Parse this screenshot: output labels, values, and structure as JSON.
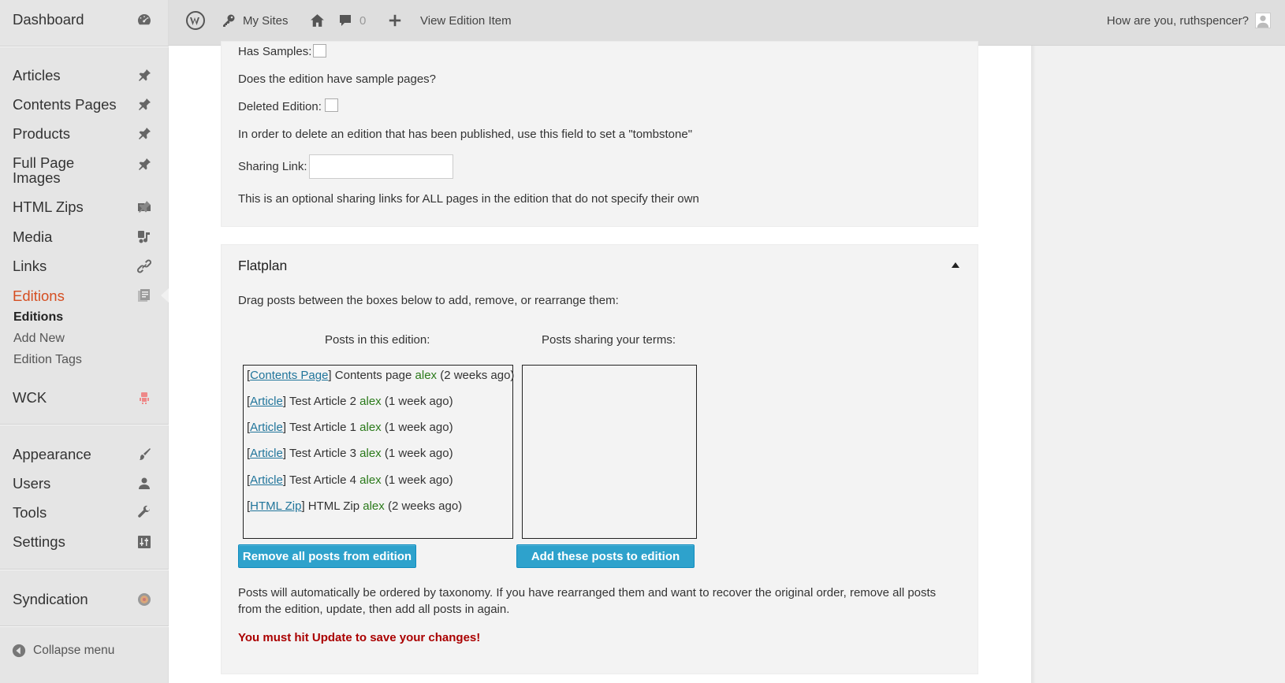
{
  "sidebar": {
    "dashboard": "Dashboard",
    "items_group1": [
      "Articles",
      "Contents Pages",
      "Products",
      "Full Page",
      "Images",
      "HTML Zips",
      "Media",
      "Links"
    ],
    "editions": "Editions",
    "editions_sub": [
      "Editions",
      "Add New",
      "Edition Tags"
    ],
    "wck": "WCK",
    "items_group2": [
      "Appearance",
      "Users",
      "Tools",
      "Settings"
    ],
    "syndication": "Syndication",
    "collapse": "Collapse menu"
  },
  "adminbar": {
    "my_sites": "My Sites",
    "comment_count": "0",
    "view_item": "View Edition Item",
    "greeting": "How are you, ruthspencer?"
  },
  "meta": {
    "has_samples_label": "Has Samples:",
    "has_samples_desc": "Does the edition have sample pages?",
    "deleted_label": "Deleted Edition:",
    "deleted_desc": "In order to delete an edition that has been published, use this field to set a \"tombstone\"",
    "sharing_label": "Sharing Link:",
    "sharing_value": "",
    "sharing_desc": "This is an optional sharing links for ALL pages in the edition that do not specify their own"
  },
  "flatplan": {
    "title": "Flatplan",
    "instructions": "Drag posts between the boxes below to add, remove, or rearrange them:",
    "col_in_edition": "Posts in this edition:",
    "col_sharing": "Posts sharing your terms:",
    "posts": [
      {
        "type": "Contents Page",
        "title": "Contents page",
        "author": "alex",
        "age": "(2 weeks ago)"
      },
      {
        "type": "Article",
        "title": "Test Article 2",
        "author": "alex",
        "age": "(1 week ago)"
      },
      {
        "type": "Article",
        "title": "Test Article 1",
        "author": "alex",
        "age": "(1 week ago)"
      },
      {
        "type": "Article",
        "title": "Test Article 3",
        "author": "alex",
        "age": "(1 week ago)"
      },
      {
        "type": "Article",
        "title": "Test Article 4",
        "author": "alex",
        "age": "(1 week ago)"
      },
      {
        "type": "HTML Zip",
        "title": "HTML Zip",
        "author": "alex",
        "age": "(2 weeks ago)"
      }
    ],
    "remove_btn": "Remove all posts from edition",
    "add_btn": "Add these posts to edition",
    "note_line1": "Posts will automatically be ordered by taxonomy. If you have rearranged them and want to recover the original order, remove all posts",
    "note_line2": "from the edition, update, then add all posts in again.",
    "warning": "You must hit Update to save your changes!"
  },
  "colors": {
    "accent": "#2ea2cc",
    "current_menu": "#d54e21",
    "author": "#2a7a1a",
    "warning": "#aa0000"
  }
}
